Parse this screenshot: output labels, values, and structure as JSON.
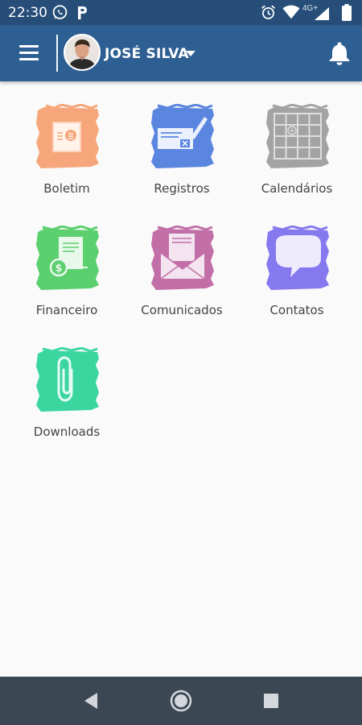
{
  "status_bar": {
    "time": "22:30",
    "network": "4G+",
    "icons": [
      "whatsapp-icon",
      "p-icon",
      "alarm-icon",
      "wifi-icon",
      "signal-icon",
      "battery-icon"
    ]
  },
  "app_bar": {
    "user_name": "JOSÉ SILVA",
    "icons": [
      "menu-icon",
      "avatar",
      "caret-down-icon",
      "bell-icon"
    ]
  },
  "tiles": [
    {
      "label": "Boletim",
      "color": "#f6a67a",
      "icon": "report-card-icon"
    },
    {
      "label": "Registros",
      "color": "#5b86e0",
      "icon": "records-icon"
    },
    {
      "label": "Calendários",
      "color": "#a3a3a3",
      "icon": "calendar-icon"
    },
    {
      "label": "Financeiro",
      "color": "#5ccf6e",
      "icon": "finance-icon"
    },
    {
      "label": "Comunicados",
      "color": "#c26fa8",
      "icon": "envelope-icon"
    },
    {
      "label": "Contatos",
      "color": "#8678ef",
      "icon": "chat-bubble-icon"
    },
    {
      "label": "Downloads",
      "color": "#3bd6a0",
      "icon": "paperclip-icon"
    }
  ],
  "nav_bar": {
    "buttons": [
      "back-icon",
      "home-icon",
      "recents-icon"
    ]
  }
}
